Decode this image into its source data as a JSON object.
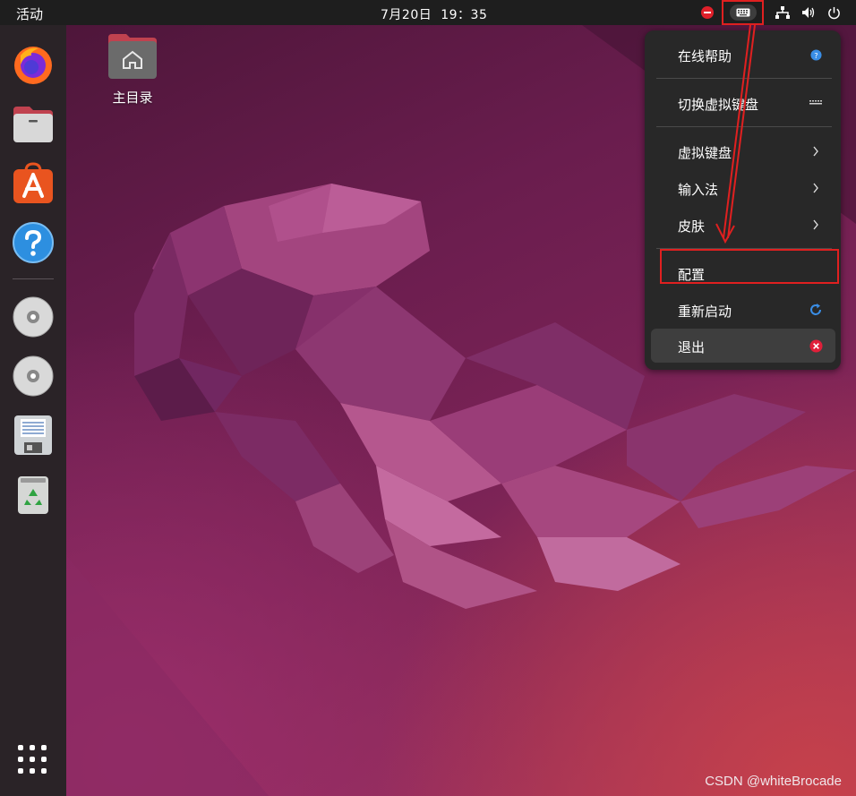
{
  "topbar": {
    "activities": "活动",
    "date": "7月20日",
    "time": "19：35"
  },
  "dock": {
    "apps": [
      {
        "name": "firefox-icon"
      },
      {
        "name": "files-icon"
      },
      {
        "name": "app-center-icon"
      },
      {
        "name": "help-icon"
      },
      {
        "name": "cd-drive-icon"
      },
      {
        "name": "cd-drive-icon"
      },
      {
        "name": "floppy-disk-icon"
      },
      {
        "name": "trash-icon"
      },
      {
        "name": "show-apps-icon"
      }
    ]
  },
  "desktop": {
    "home_folder_label": "主目录"
  },
  "menu": {
    "items": [
      {
        "label": "在线帮助",
        "icon": "help-circle-icon"
      },
      {
        "label": "切换虚拟键盘",
        "icon": "keyboard-icon"
      },
      {
        "label": "虚拟键盘",
        "icon": "chevron-right-icon"
      },
      {
        "label": "输入法",
        "icon": "chevron-right-icon"
      },
      {
        "label": "皮肤",
        "icon": "chevron-right-icon"
      },
      {
        "label": "配置",
        "icon": ""
      },
      {
        "label": "重新启动",
        "icon": "refresh-icon"
      },
      {
        "label": "退出",
        "icon": "close-circle-icon"
      }
    ]
  },
  "annotations": {
    "highlight_color": "#e02020"
  },
  "watermark": "CSDN @whiteBrocade"
}
